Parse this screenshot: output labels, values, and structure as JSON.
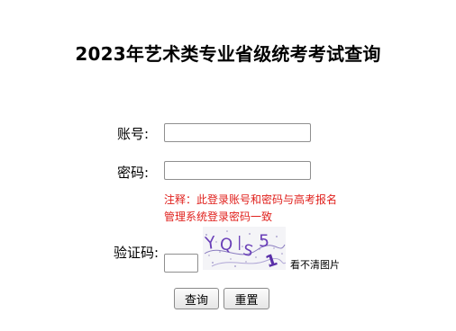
{
  "page": {
    "title": "2023年艺术类专业省级统考考试查询"
  },
  "form": {
    "account_label": "账号:",
    "account_value": "",
    "password_label": "密码:",
    "password_value": "",
    "note_line1": "注释：此登录账号和密码与高考报名",
    "note_line2": "管理系统登录密码一致",
    "captcha_label": "验证码:",
    "captcha_value": "",
    "captcha_image_text": "YQ S 5 1",
    "captcha_refresh_link": "看不清图片",
    "query_button": "查询",
    "reset_button": "重置"
  },
  "colors": {
    "note": "#e0201c",
    "captcha_text": "#6a3fb8"
  }
}
